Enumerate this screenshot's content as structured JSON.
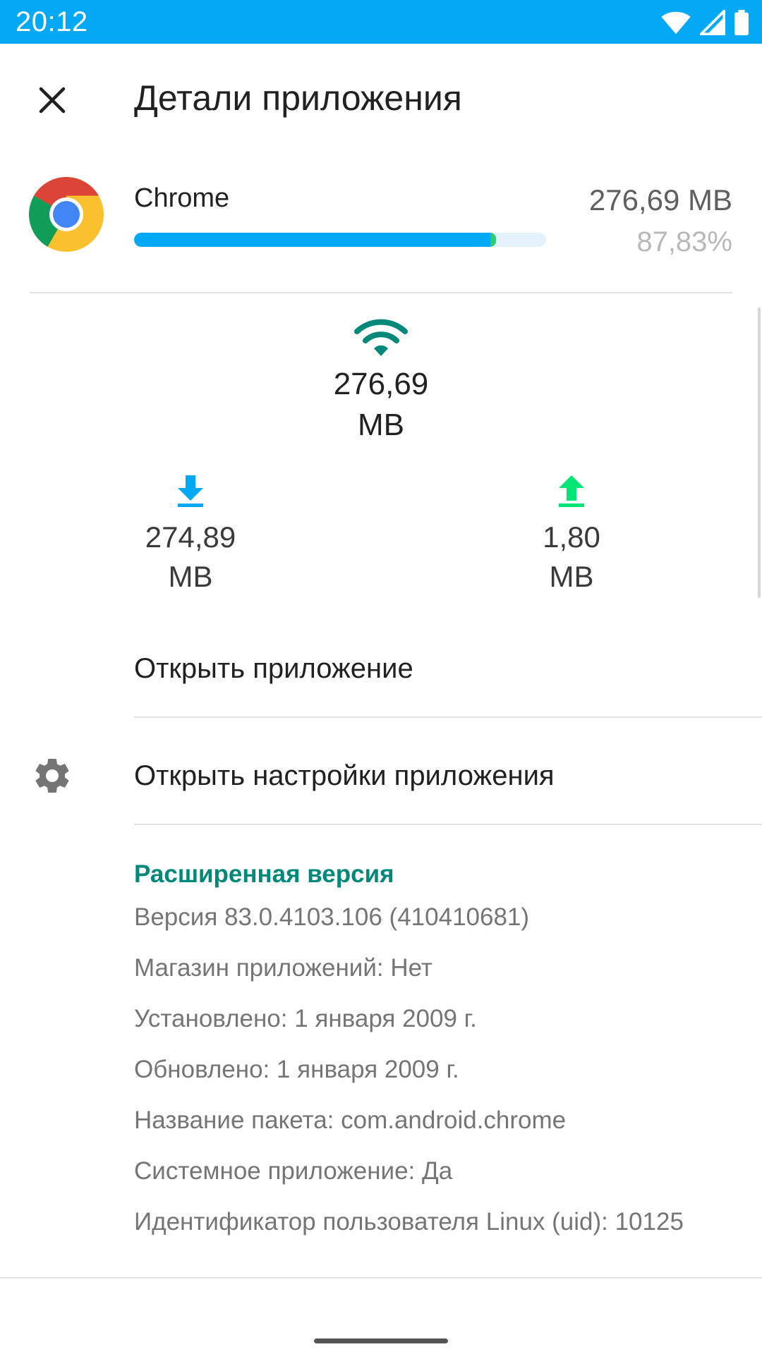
{
  "status_bar": {
    "time": "20:12",
    "icons": [
      "wifi-icon",
      "signal-icon",
      "battery-icon"
    ],
    "color": "#03a9f4"
  },
  "toolbar": {
    "close_icon": "close-icon",
    "title": "Детали приложения"
  },
  "app": {
    "name": "Chrome",
    "icon": "chrome-logo",
    "size": "276,69 MB",
    "percent": "87,83%",
    "usage_fraction": 0.8783
  },
  "traffic": {
    "total_icon": "wifi-icon",
    "total_value": "276,69",
    "total_unit": "MB",
    "download": {
      "icon": "download-icon",
      "value": "274,89",
      "unit": "MB",
      "color": "#03a9f4"
    },
    "upload": {
      "icon": "upload-icon",
      "value": "1,80",
      "unit": "MB",
      "color": "#00e676"
    }
  },
  "actions": {
    "open_app": "Открыть приложение",
    "open_settings": "Открыть настройки приложения",
    "settings_icon": "gear-icon"
  },
  "advanced": {
    "title": "Расширенная версия",
    "accent_color": "#00897b",
    "lines": [
      "Версия 83.0.4103.106 (410410681)",
      "Магазин приложений: Нет",
      "Установлено: 1 января 2009 г.",
      "Обновлено: 1 января 2009 г.",
      "Название пакета: com.android.chrome",
      "Системное приложение: Да",
      "Идентификатор пользователя Linux (uid): 10125"
    ]
  }
}
